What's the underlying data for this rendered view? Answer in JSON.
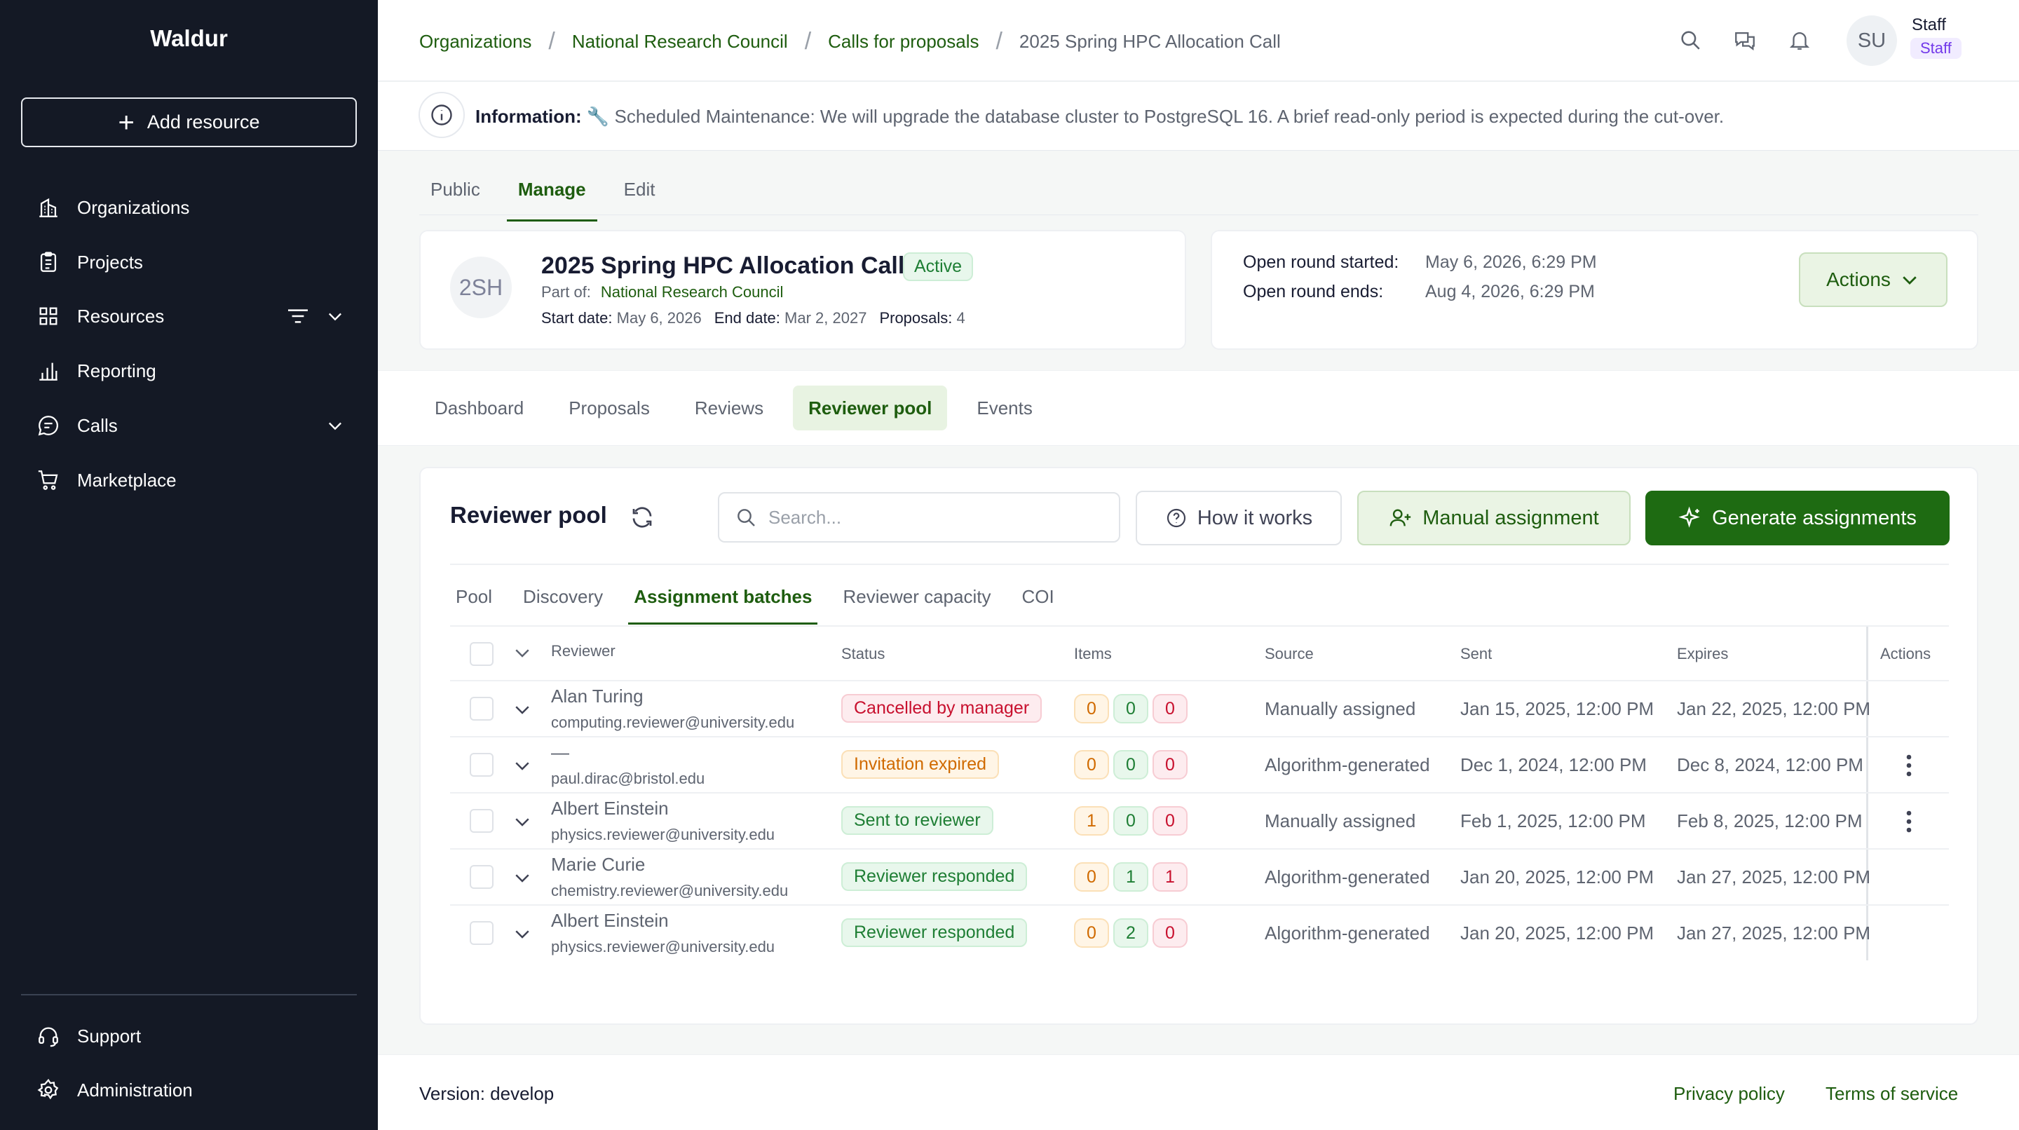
{
  "app": {
    "brand": "Waldur",
    "add_resource": "Add resource"
  },
  "sidebar": {
    "items": [
      {
        "label": "Organizations",
        "icon": "building-icon"
      },
      {
        "label": "Projects",
        "icon": "clipboard-icon"
      },
      {
        "label": "Resources",
        "icon": "grid-icon"
      },
      {
        "label": "Reporting",
        "icon": "bar-chart-icon"
      },
      {
        "label": "Calls",
        "icon": "chat-icon"
      },
      {
        "label": "Marketplace",
        "icon": "cart-icon"
      }
    ],
    "bottom": [
      {
        "label": "Support",
        "icon": "headset-icon"
      },
      {
        "label": "Administration",
        "icon": "gear-icon"
      }
    ]
  },
  "breadcrumb": [
    "Organizations",
    "National Research Council",
    "Calls for proposals",
    "2025 Spring HPC Allocation Call"
  ],
  "user": {
    "initials": "SU",
    "name": "Staff",
    "role": "Staff"
  },
  "banner": {
    "label": "Information:",
    "text": "🔧 Scheduled Maintenance: We will upgrade the database cluster to PostgreSQL 16. A brief read-only period is expected during the cut-over."
  },
  "page_tabs": [
    "Public",
    "Manage",
    "Edit"
  ],
  "call": {
    "initials": "2SH",
    "title": "2025 Spring HPC Allocation Call",
    "status": "Active",
    "part_of_label": "Part of:",
    "part_of": "National Research Council",
    "start_label": "Start date:",
    "start": "May 6, 2026",
    "end_label": "End date:",
    "end": "Mar 2, 2027",
    "proposals_label": "Proposals:",
    "proposals": "4"
  },
  "round": {
    "started_label": "Open round started:",
    "started": "May 6, 2026, 6:29 PM",
    "ends_label": "Open round ends:",
    "ends": "Aug 4, 2026, 6:29 PM",
    "actions": "Actions"
  },
  "section_tabs": [
    "Dashboard",
    "Proposals",
    "Reviews",
    "Reviewer pool",
    "Events"
  ],
  "pool": {
    "title": "Reviewer pool",
    "search_placeholder": "Search...",
    "how_it_works": "How it works",
    "manual": "Manual assignment",
    "generate": "Generate assignments",
    "sub_tabs": [
      "Pool",
      "Discovery",
      "Assignment batches",
      "Reviewer capacity",
      "COI"
    ],
    "columns": {
      "reviewer": "Reviewer",
      "status": "Status",
      "items": "Items",
      "source": "Source",
      "sent": "Sent",
      "expires": "Expires",
      "actions": "Actions"
    },
    "rows": [
      {
        "name": "Alan Turing",
        "email": "computing.reviewer@university.edu",
        "status": "Cancelled by manager",
        "items": [
          "0",
          "0",
          "0"
        ],
        "source": "Manually assigned",
        "sent": "Jan 15, 2025, 12:00 PM",
        "expires": "Jan 22, 2025, 12:00 PM"
      },
      {
        "name": "—",
        "email": "paul.dirac@bristol.edu",
        "status": "Invitation expired",
        "items": [
          "0",
          "0",
          "0"
        ],
        "source": "Algorithm-generated",
        "sent": "Dec 1, 2024, 12:00 PM",
        "expires": "Dec 8, 2024, 12:00 PM"
      },
      {
        "name": "Albert Einstein",
        "email": "physics.reviewer@university.edu",
        "status": "Sent to reviewer",
        "items": [
          "1",
          "0",
          "0"
        ],
        "source": "Manually assigned",
        "sent": "Feb 1, 2025, 12:00 PM",
        "expires": "Feb 8, 2025, 12:00 PM"
      },
      {
        "name": "Marie Curie",
        "email": "chemistry.reviewer@university.edu",
        "status": "Reviewer responded",
        "items": [
          "0",
          "1",
          "1"
        ],
        "source": "Algorithm-generated",
        "sent": "Jan 20, 2025, 12:00 PM",
        "expires": "Jan 27, 2025, 12:00 PM"
      },
      {
        "name": "Albert Einstein",
        "email": "physics.reviewer@university.edu",
        "status": "Reviewer responded",
        "items": [
          "0",
          "2",
          "0"
        ],
        "source": "Algorithm-generated",
        "sent": "Jan 20, 2025, 12:00 PM",
        "expires": "Jan 27, 2025, 12:00 PM"
      }
    ]
  },
  "footer": {
    "version": "Version: develop",
    "privacy": "Privacy policy",
    "terms": "Terms of service"
  }
}
